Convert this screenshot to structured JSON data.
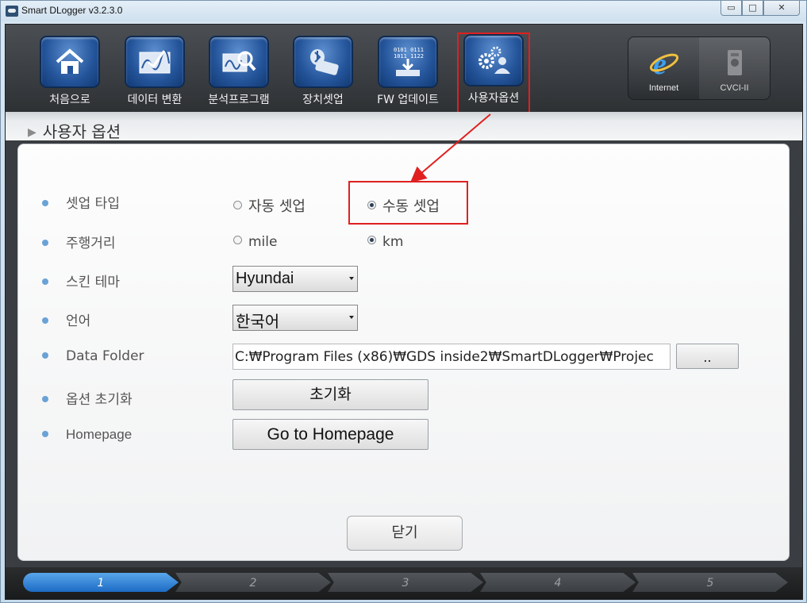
{
  "window": {
    "title": "Smart DLogger v3.2.3.0",
    "controls": {
      "minimize": "▭",
      "maximize": "□",
      "close": "✕"
    }
  },
  "toolbar": {
    "items": [
      {
        "label": "처음으로",
        "icon": "home-icon"
      },
      {
        "label": "데이터 변환",
        "icon": "data-convert-icon"
      },
      {
        "label": "분석프로그램",
        "icon": "analysis-icon"
      },
      {
        "label": "장치셋업",
        "icon": "device-setup-icon"
      },
      {
        "label": "FW 업데이트",
        "icon": "firmware-update-icon",
        "chip_text": "0101 0111\n1011 1122"
      },
      {
        "label": "사용자옵션",
        "icon": "user-options-icon",
        "active": true
      }
    ],
    "right_items": [
      {
        "label": "Internet",
        "icon": "internet-explorer-icon"
      },
      {
        "label": "CVCI-II",
        "icon": "cvci-device-icon"
      }
    ]
  },
  "page": {
    "title": "사용자 옵션"
  },
  "options": {
    "setup_type": {
      "label": "셋업 타입",
      "choices": [
        "자동 셋업",
        "수동 셋업"
      ],
      "selected": "수동 셋업"
    },
    "distance": {
      "label": "주행거리",
      "choices": [
        "mile",
        "km"
      ],
      "selected": "km"
    },
    "skin": {
      "label": "스킨 테마",
      "value": "Hyundai"
    },
    "language": {
      "label": "언어",
      "value": "한국어"
    },
    "data_folder": {
      "label": "Data Folder",
      "value": "C:₩Program Files (x86)₩GDS inside2₩SmartDLogger₩Projec",
      "browse_label": ".."
    },
    "reset": {
      "label": "옵션 초기화",
      "button": "초기화"
    },
    "homepage": {
      "label": "Homepage",
      "button": "Go to Homepage"
    }
  },
  "close_button": "닫기",
  "steps": [
    "1",
    "2",
    "3",
    "4",
    "5"
  ],
  "active_step": "1",
  "colors": {
    "highlight": "#e02020",
    "accent": "#1d6bc4",
    "bullet": "#6aa2d6"
  }
}
